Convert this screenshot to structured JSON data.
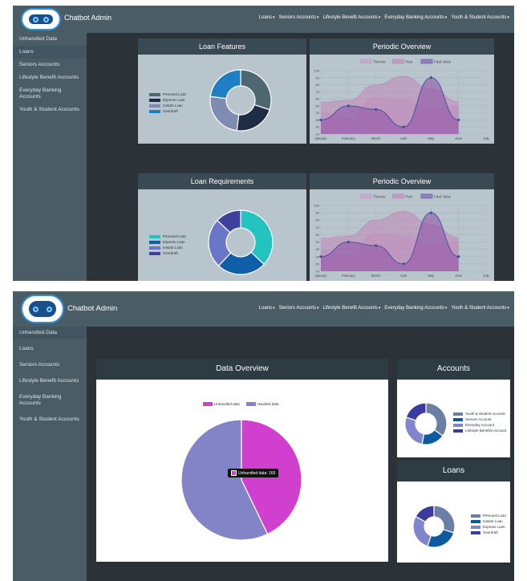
{
  "brand": {
    "title": "Chatbot Admin"
  },
  "nav": {
    "items": [
      "Loans",
      "Seniors Accounts",
      "Lifestyle Benefit Accounts",
      "Everyday Banking Accounts",
      "Youth & Student Accounts"
    ]
  },
  "sidebar": {
    "items": [
      "Unhandled Data",
      "Loans",
      "Seniors Accounts",
      "Lifestyle Benefit Accounts",
      "Everyday Banking Accounts",
      "Youth & Student Accounts"
    ]
  },
  "screen1": {
    "loan_features": {
      "title": "Loan Features",
      "legend": [
        "Personal Loan",
        "Express Loan",
        "Instant Loan",
        "Overdraft"
      ],
      "chart_data": {
        "type": "pie",
        "labels": [
          "Personal Loan",
          "Express Loan",
          "Instant Loan",
          "Overdraft"
        ],
        "values": [
          30,
          22,
          25,
          23
        ],
        "colors": [
          "#4f6770",
          "#1f2c45",
          "#7d8cb0",
          "#1e7fc4"
        ]
      }
    },
    "periodic_1": {
      "title": "Periodic Overview",
      "legend": [
        "Thomas",
        "Rest",
        "Filed Value"
      ],
      "chart_data": {
        "type": "area",
        "categories": [
          "January",
          "February",
          "March",
          "April",
          "May",
          "June",
          "July"
        ],
        "yticks": [
          10,
          20,
          30,
          40,
          50,
          60,
          70,
          80,
          90,
          100
        ],
        "ylim": [
          10,
          100
        ],
        "series": [
          {
            "name": "Thomas",
            "values": [
              40,
              32,
              62,
              58,
              46,
              50,
              null
            ],
            "color": "#c59ac6"
          },
          {
            "name": "Rest",
            "values": [
              55,
              58,
              80,
              92,
              74,
              56,
              null
            ],
            "color": "#c282b5"
          },
          {
            "name": "Filed Value",
            "values": [
              30,
              50,
              45,
              20,
              90,
              30,
              null
            ],
            "color": "#8c4fa6"
          }
        ]
      }
    },
    "loan_requirements": {
      "title": "Loan Requirements",
      "legend": [
        "Personal Loan",
        "Express Loan",
        "Instant Loan",
        "Overdraft"
      ],
      "chart_data": {
        "type": "pie",
        "labels": [
          "Personal Loan",
          "Express Loan",
          "Instant Loan",
          "Overdraft"
        ],
        "values": [
          37,
          25,
          25,
          13
        ],
        "colors": [
          "#23c4bf",
          "#0f5ea8",
          "#6a76c8",
          "#3f3f9e"
        ]
      }
    },
    "periodic_2": {
      "title": "Periodic Overview",
      "legend": [
        "Thomas",
        "Rest",
        "Filed Value"
      ],
      "chart_data": {
        "type": "area",
        "categories": [
          "January",
          "February",
          "March",
          "April",
          "May",
          "June",
          "July"
        ],
        "yticks": [
          10,
          20,
          30,
          40,
          50,
          60,
          70,
          80,
          90,
          100
        ],
        "ylim": [
          10,
          100
        ],
        "series": [
          {
            "name": "Thomas",
            "values": [
              40,
              32,
              62,
              58,
              46,
              50,
              null
            ],
            "color": "#c59ac6"
          },
          {
            "name": "Rest",
            "values": [
              55,
              58,
              80,
              92,
              74,
              56,
              null
            ],
            "color": "#c282b5"
          },
          {
            "name": "Filed Value",
            "values": [
              30,
              50,
              45,
              20,
              90,
              30,
              null
            ],
            "color": "#8c4fa6"
          }
        ]
      }
    }
  },
  "screen2": {
    "data_overview": {
      "title": "Data Overview",
      "legend": [
        "Unhandled data",
        "Handled data"
      ],
      "tooltip": "Unhandled data: 165",
      "chart_data": {
        "type": "pie",
        "labels": [
          "Unhandled data",
          "Handled data"
        ],
        "values": [
          165,
          220
        ],
        "colors": [
          "#d03fcd",
          "#8383c8"
        ]
      }
    },
    "accounts": {
      "title": "Accounts",
      "legend": [
        "Youth & Student Account",
        "Seniors Account",
        "Everyday Account",
        "Lifestyle Benefits Account"
      ],
      "chart_data": {
        "type": "pie",
        "labels": [
          "Youth & Student Account",
          "Seniors Account",
          "Everyday Account",
          "Lifestyle Benefits Account"
        ],
        "values": [
          35,
          18,
          27,
          20
        ],
        "colors": [
          "#6b7ea3",
          "#0d5aa0",
          "#7f86cc",
          "#3b3aa0"
        ]
      }
    },
    "loans": {
      "title": "Loans",
      "legend": [
        "Personal Loan",
        "Instant Loan",
        "Express Loan",
        "Overdraft"
      ],
      "chart_data": {
        "type": "pie",
        "labels": [
          "Personal Loan",
          "Instant Loan",
          "Express Loan",
          "Overdraft"
        ],
        "values": [
          30,
          25,
          28,
          17
        ],
        "colors": [
          "#6b7ea3",
          "#0d5aa0",
          "#7f86cc",
          "#3b3aa0"
        ]
      }
    }
  }
}
